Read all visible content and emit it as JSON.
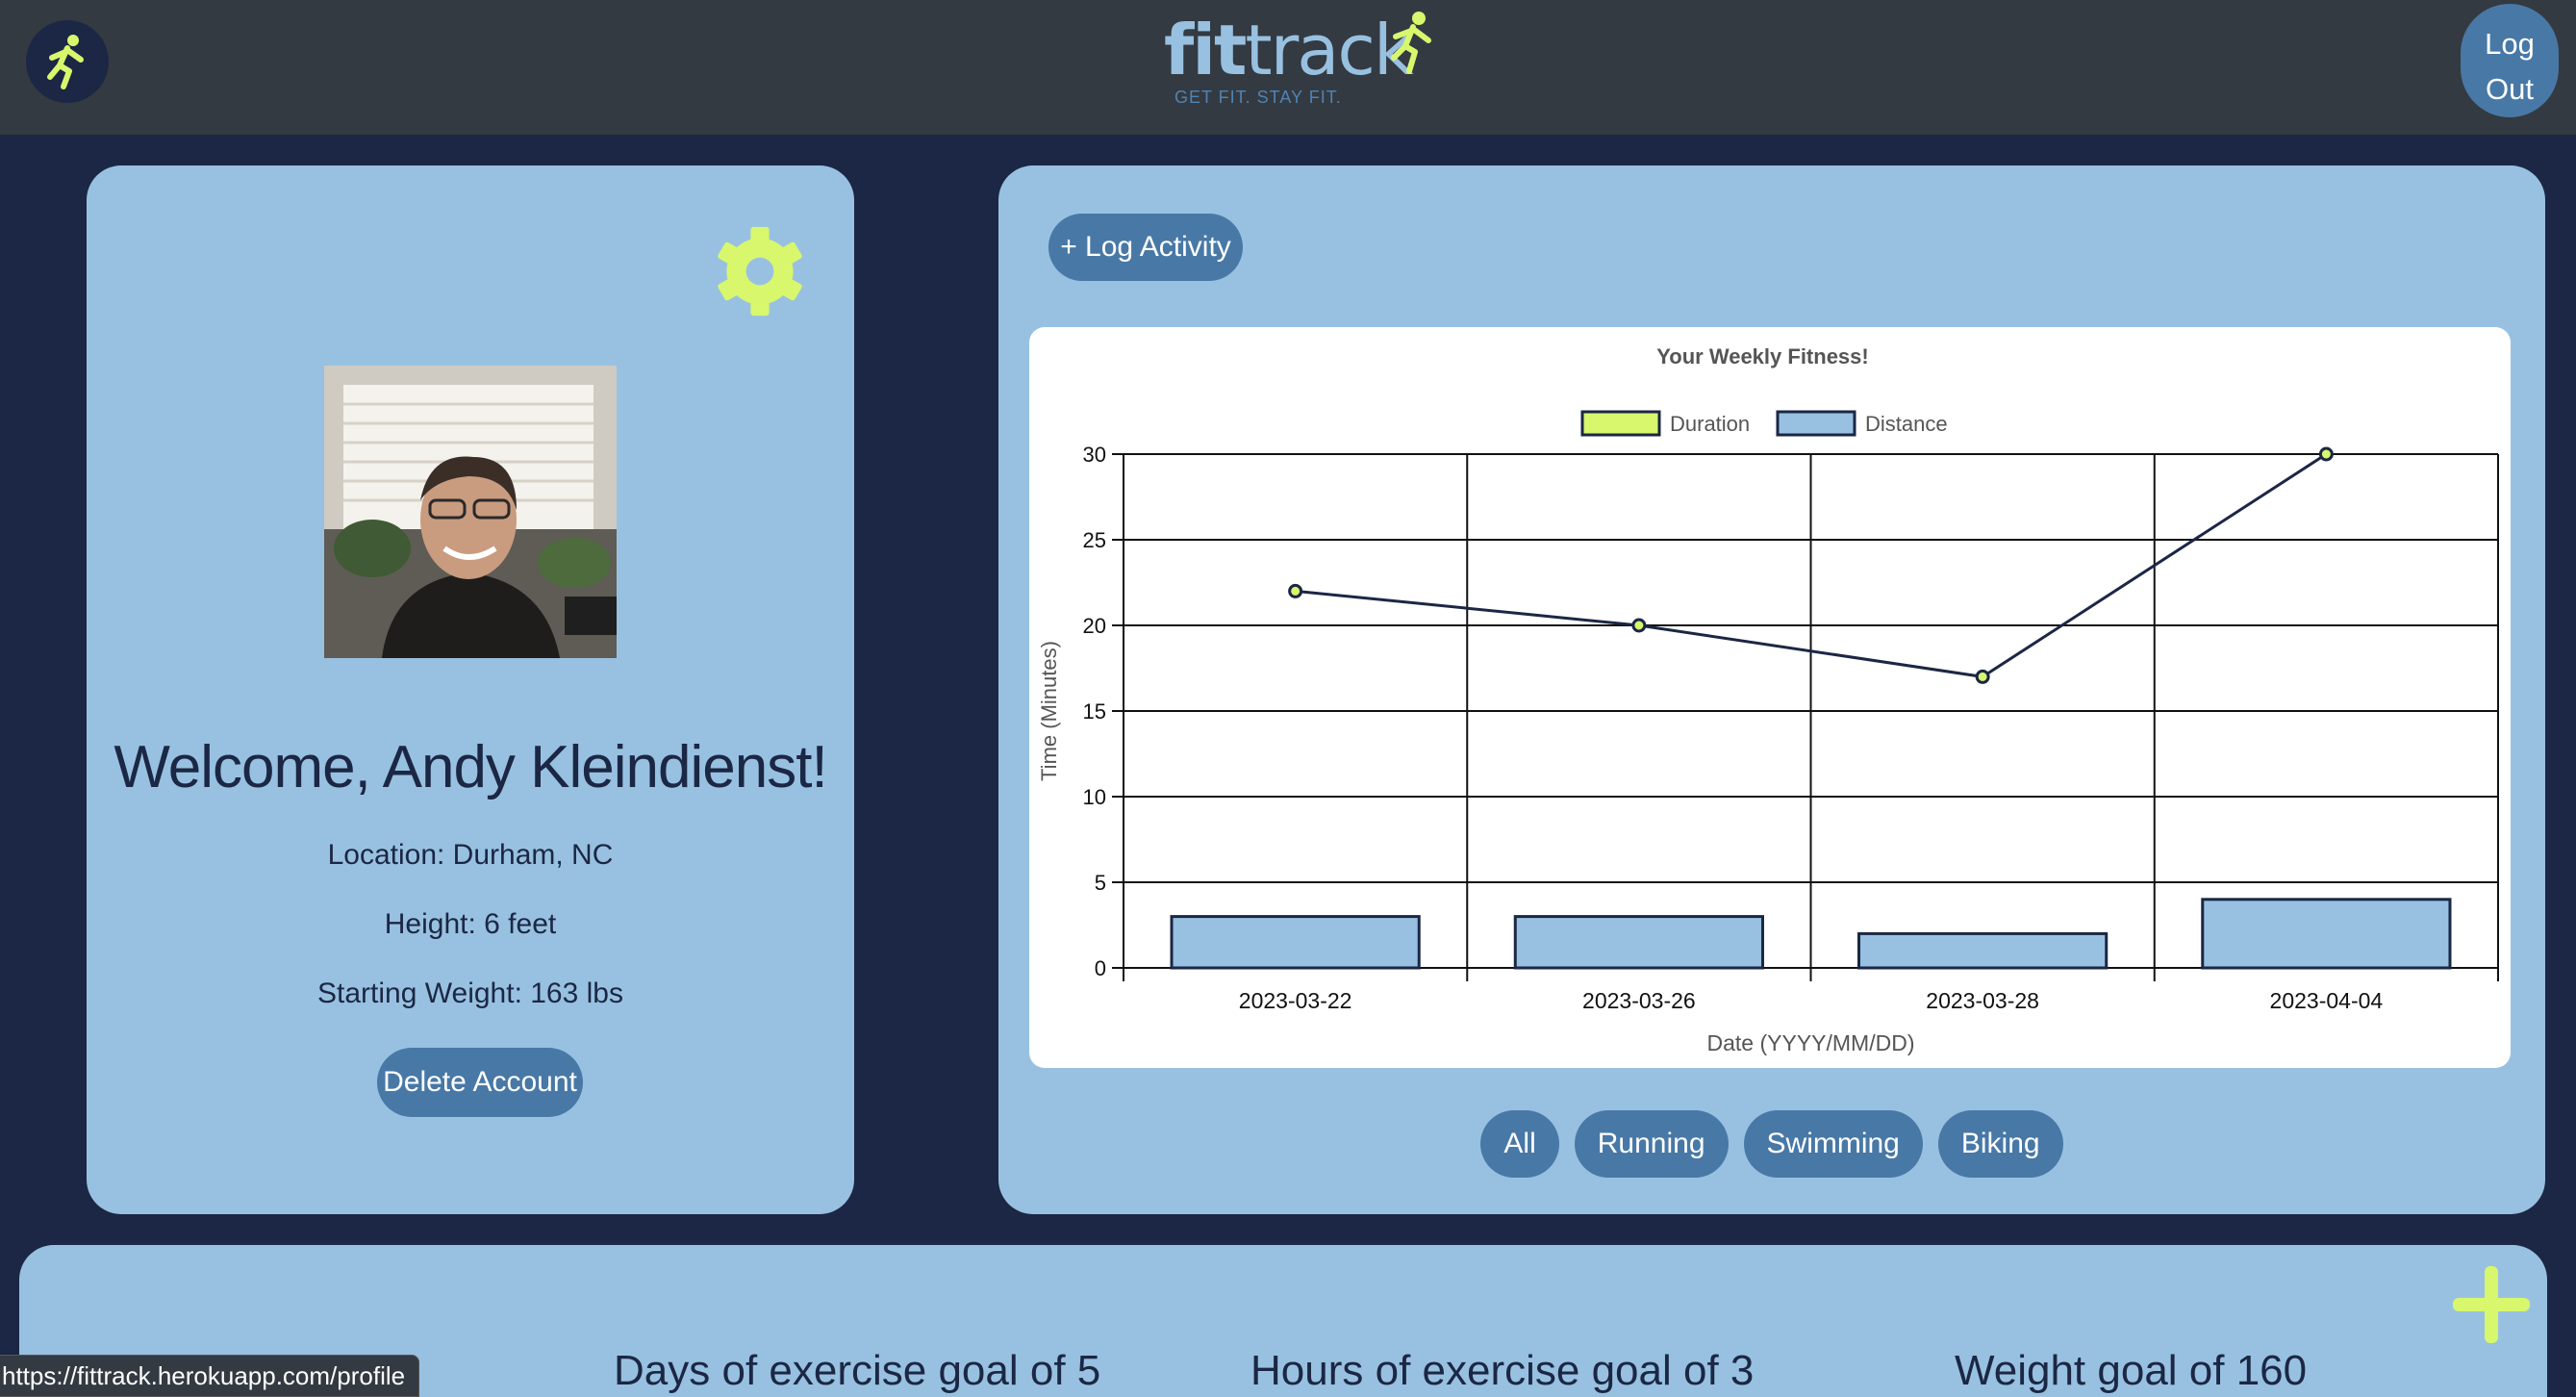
{
  "header": {
    "logo_fit": "fit",
    "logo_track": "track",
    "logo_tagline": "GET FIT. STAY FIT.",
    "logout_label": "Log\nOut"
  },
  "profile": {
    "welcome": "Welcome, Andy Kleindienst!",
    "location": "Location: Durham, NC",
    "height": "Height: 6 feet",
    "starting_weight": "Starting Weight: 163 lbs",
    "delete_label": "Delete Account"
  },
  "activity": {
    "log_label": "+ Log Activity",
    "filters": [
      "All",
      "Running",
      "Swimming",
      "Biking"
    ]
  },
  "goals": {
    "items": [
      "Days of exercise goal of 5",
      "Hours of exercise goal of 3",
      "Weight goal of 160"
    ]
  },
  "status_url": "https://fittrack.herokuapp.com/profile",
  "colors": {
    "navy": "#1b2744",
    "card": "#98c1e1",
    "button": "#4878a6",
    "accent": "#d8f76d",
    "topbar": "#343a41"
  },
  "chart_data": {
    "type": "bar",
    "title": "Your Weekly Fitness!",
    "xlabel": "Date (YYYY/MM/DD)",
    "ylabel": "Time (Minutes)",
    "categories": [
      "2023-03-22",
      "2023-03-26",
      "2023-03-28",
      "2023-04-04"
    ],
    "ylim": [
      0,
      30
    ],
    "yticks": [
      0,
      5,
      10,
      15,
      20,
      25,
      30
    ],
    "grid": true,
    "legend": "top-center",
    "series": [
      {
        "name": "Duration",
        "type": "line",
        "values": [
          22,
          20,
          17,
          30
        ],
        "color": "#d8f76d",
        "line_color": "#1b2744"
      },
      {
        "name": "Distance",
        "type": "bar",
        "values": [
          3,
          3,
          2,
          4
        ],
        "color": "#98c1e1"
      }
    ]
  }
}
